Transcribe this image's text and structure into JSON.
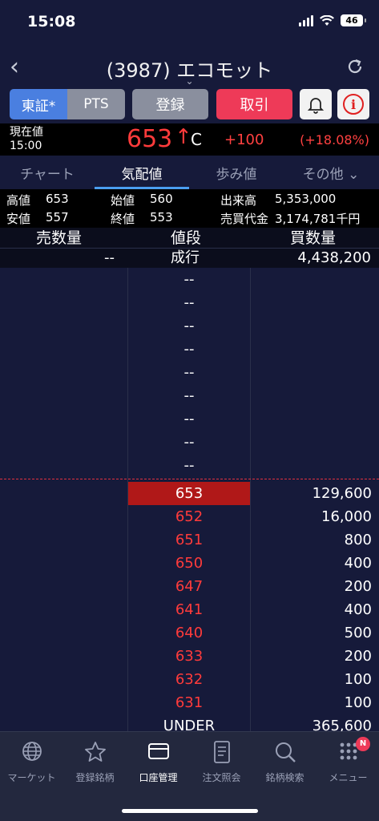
{
  "status_bar": {
    "time": "15:08",
    "battery": "46"
  },
  "header": {
    "title": "(3987) エコモット",
    "caret": "⌄"
  },
  "actions": {
    "market_tse": "東証*",
    "market_pts": "PTS",
    "register": "登録",
    "trade": "取引",
    "info": "i"
  },
  "price": {
    "label_line1": "現在値",
    "label_line2": "15:00",
    "current": "653",
    "arrow": "↑",
    "flag": "C",
    "change": "+100",
    "change_pct": "(+18.08%)"
  },
  "tabs": [
    {
      "label": "チャート"
    },
    {
      "label": "気配値"
    },
    {
      "label": "歩み値"
    },
    {
      "label": "その他 ⌄"
    }
  ],
  "stats": {
    "high_label": "高値",
    "high": "653",
    "open_label": "始値",
    "open": "560",
    "volume_label": "出来高",
    "volume": "5,353,000",
    "low_label": "安値",
    "low": "557",
    "close_label": "終値",
    "close": "553",
    "turnover_label": "売買代金",
    "turnover": "3,174,781千円"
  },
  "book_header": {
    "ask": "売数量",
    "price": "値段",
    "bid": "買数量"
  },
  "market_order": {
    "ask": "--",
    "price": "成行",
    "bid": "4,438,200"
  },
  "asks": [
    "--",
    "--",
    "--",
    "--",
    "--",
    "--",
    "--",
    "--",
    "--"
  ],
  "bids": [
    {
      "price": "653",
      "qty": "129,600"
    },
    {
      "price": "652",
      "qty": "16,000"
    },
    {
      "price": "651",
      "qty": "800"
    },
    {
      "price": "650",
      "qty": "400"
    },
    {
      "price": "647",
      "qty": "200"
    },
    {
      "price": "641",
      "qty": "400"
    },
    {
      "price": "640",
      "qty": "500"
    },
    {
      "price": "633",
      "qty": "200"
    },
    {
      "price": "632",
      "qty": "100"
    },
    {
      "price": "631",
      "qty": "100"
    }
  ],
  "under": {
    "price": "UNDER",
    "qty": "365,600"
  },
  "bottom_nav": [
    {
      "label": "マーケット",
      "icon": "globe-icon"
    },
    {
      "label": "登録銘柄",
      "icon": "star-icon"
    },
    {
      "label": "口座管理",
      "icon": "card-icon"
    },
    {
      "label": "注文照会",
      "icon": "document-icon"
    },
    {
      "label": "銘柄検索",
      "icon": "search-icon"
    },
    {
      "label": "メニュー",
      "icon": "grid-icon",
      "badge": "N"
    }
  ],
  "colors": {
    "up": "#ff3b3b",
    "trade_button": "#ee3a58",
    "active_segment": "#4a7fe0",
    "tab_underline": "#4a9ef0"
  }
}
